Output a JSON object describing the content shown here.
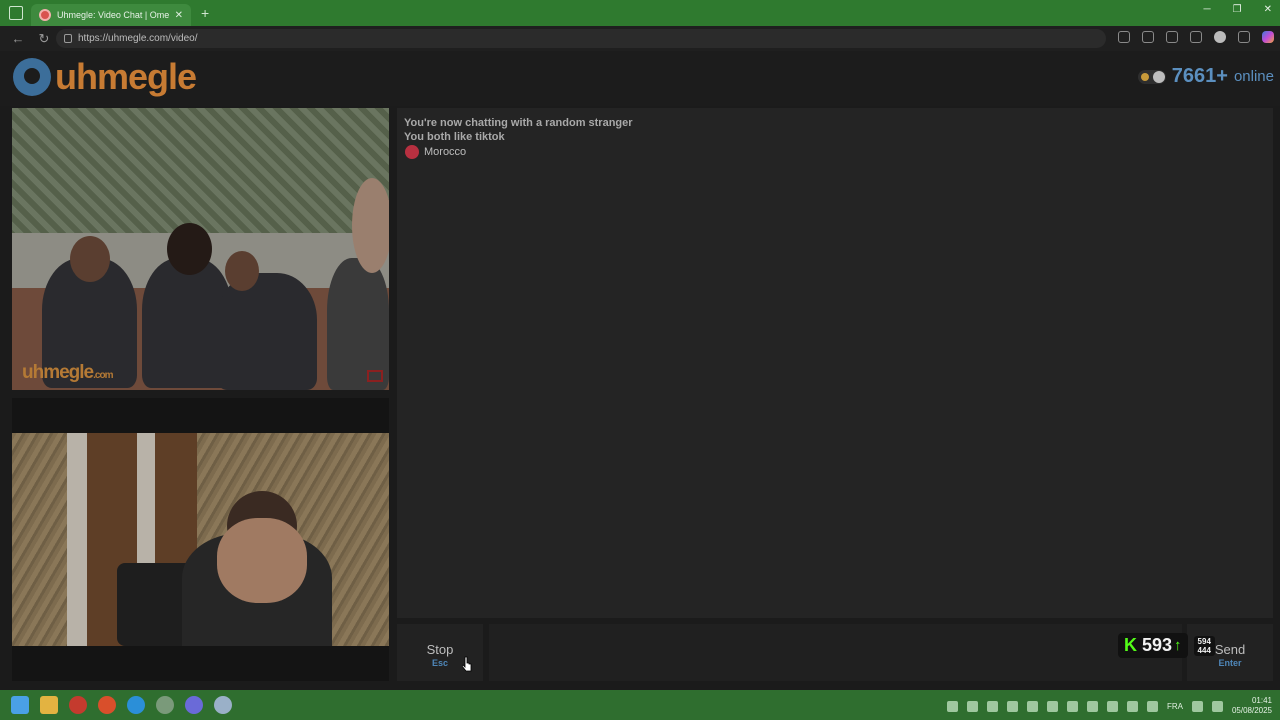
{
  "browser": {
    "tab_title": "Uhmegle: Video Chat | Ome",
    "url": "https://uhmegle.com/video/"
  },
  "header": {
    "logo_text": "uhmegle",
    "online_count": "7661+",
    "online_label": "online"
  },
  "video": {
    "stranger_watermark": "uhmegle",
    "stranger_watermark_suffix": ".com"
  },
  "chat": {
    "messages": [
      "You're now chatting with a random stranger",
      "You both like tiktok"
    ],
    "country": "Morocco"
  },
  "controls": {
    "stop_label": "Stop",
    "stop_key": "Esc",
    "send_label": "Send",
    "send_key": "Enter"
  },
  "stream_overlay": {
    "viewers": "593",
    "stat_top": "594",
    "stat_bottom": "444"
  },
  "taskbar": {
    "language": "FRA",
    "time": "01:41",
    "date": "05/08/2025"
  },
  "colors": {
    "accent_blue": "#5b8fbf",
    "logo_orange": "#c77b33",
    "kick_green": "#53fc18"
  }
}
